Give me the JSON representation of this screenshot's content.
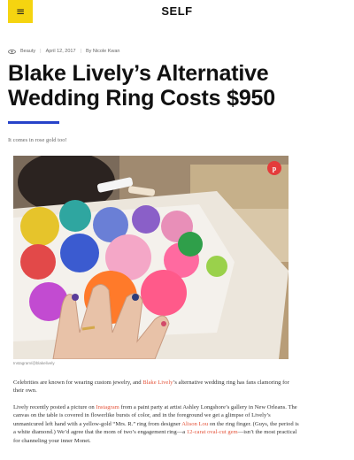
{
  "header": {
    "menu_icon": "hamburger-menu-icon",
    "menu_glyph": "≡",
    "logo": "SELF",
    "menu_color": "#f5d410"
  },
  "article": {
    "category": "Beauty",
    "category_icon": "eye-icon",
    "date": "April 12, 2017",
    "byline": "By Nicole Kwan",
    "headline": "Blake Lively’s Alternative Wedding Ring Costs $950",
    "dek": "It comes in rose gold too!",
    "accent_color": "#2743c9",
    "link_color": "#e4543b"
  },
  "image": {
    "credit": "Instagram/@blakelively",
    "pin_label": "p",
    "pin_icon": "pinterest-icon",
    "pin_color": "#e43b3b"
  },
  "body": {
    "p1_a": "Celebrities are known for wearing custom jewelry, and ",
    "p1_link": "Blake Lively",
    "p1_b": "’s alternative wedding ring has fans clamoring for their own.",
    "p2_a": "Lively recently posted a picture on ",
    "p2_link1": "Instagram",
    "p2_b": " from a paint party at artist Ashley Longshore’s gallery in New Orleans. The canvas on the table is covered in flowerlike bursts of color, and in the foreground we get a glimpse of Lively’s unmanicured left hand with a yellow-gold “Mrs. R.” ring from designer ",
    "p2_link2": "Alison Lou",
    "p2_c": " on the ring finger. (Guys, the period is a white diamond.) We’d agree that the mom of two’s engagement ring—a ",
    "p2_link3": "12-carat oval-cut gem",
    "p2_d": "—isn’t the most practical for channeling your inner Monet."
  }
}
